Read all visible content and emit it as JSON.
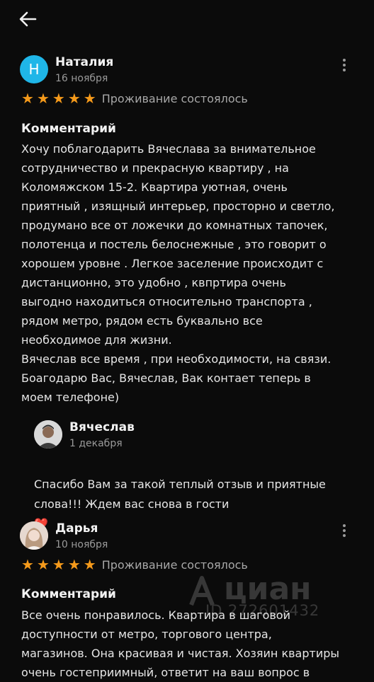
{
  "reviews": [
    {
      "author": "Наталия",
      "avatar_letter": "Н",
      "date": "16 ноября",
      "rating": 5,
      "status": "Проживание состоялось",
      "comment_title": "Комментарий",
      "comment_text": "Хочу поблагодарить Вячеслава за внимательное\nсотрудничество и прекрасную квартиру , на\nКоломяжском  15-2. Квартира уютная, очень\nприятный , изящный интерьер, просторно и светло,\nпродумано все от ложечки до комнатных тапочек,\nполотенца и постель белоснежные , это говорит о\nхорошем уровне . Легкое заселение происходит с\nдистанционно, это удобно , квпртира очень\nвыгодно находиться относительно транспорта ,\nрядом метро, рядом есть буквально все\nнеобходимое для жизни.\nВячеслав все время , при необходимости, на связи.\nБоагодарю Вас, Вячеслав, Вак контает теперь в\nмоем телефоне)",
      "reply": {
        "author": "Вячеслав",
        "date": "1 декабря",
        "text": "Спасибо Вам за такой теплый отзыв и приятные\nслова!!! Ждем вас снова в гости",
        "emoji": "❤️"
      }
    },
    {
      "author": "Дарья",
      "date": "10 ноября",
      "rating": 5,
      "status": "Проживание состоялось",
      "comment_title": "Комментарий",
      "comment_text": "Все очень понравилось. Квартира в шаговой\nдоступности от метро, торгового центра,\nмагазинов. Она красивая и чистая. Хозяин квартиры\nочень гостеприимный, ответит на ваш вопрос в"
    }
  ],
  "watermark": {
    "brand": "циан",
    "id_text": "ID 272601432"
  },
  "colors": {
    "background": "#0b0b0b",
    "star": "#f59a1b",
    "avatar_accent": "#1fb6e8"
  }
}
